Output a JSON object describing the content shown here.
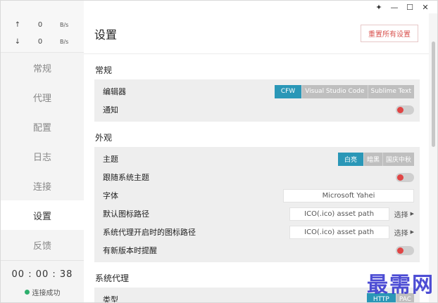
{
  "speed": {
    "up_arrow": "↑",
    "up_value": "0",
    "up_unit": "B/s",
    "down_arrow": "↓",
    "down_value": "0",
    "down_unit": "B/s"
  },
  "sidebar": {
    "items": [
      {
        "label": "常规"
      },
      {
        "label": "代理"
      },
      {
        "label": "配置"
      },
      {
        "label": "日志"
      },
      {
        "label": "连接"
      },
      {
        "label": "设置"
      },
      {
        "label": "反馈"
      }
    ],
    "active_index": 5,
    "timer": "00 : 00 : 38",
    "status": "连接成功",
    "status_color": "#2eaf6d"
  },
  "titlebar": {
    "pin": "✦",
    "minimize": "—",
    "maximize": "☐",
    "close": "✕"
  },
  "header": {
    "title": "设置",
    "reset_label": "重置所有设置"
  },
  "sections": {
    "general": {
      "title": "常规",
      "editor_label": "编辑器",
      "editor_options": [
        "CFW",
        "Visual Studio Code",
        "Sublime Text"
      ],
      "editor_selected": "CFW",
      "notify_label": "通知"
    },
    "appearance": {
      "title": "外观",
      "theme_label": "主题",
      "theme_options": [
        "白亮",
        "暗黑",
        "国庆中秋"
      ],
      "theme_selected": "白亮",
      "follow_system_label": "跟随系统主题",
      "font_label": "字体",
      "font_value": "Microsoft Yahei",
      "default_icon_label": "默认图标路径",
      "default_icon_placeholder": "ICO(.ico) asset path",
      "default_icon_choose": "选择",
      "proxy_icon_label": "系统代理开启时的图标路径",
      "proxy_icon_placeholder": "ICO(.ico) asset path",
      "proxy_icon_choose": "选择",
      "update_label": "有新版本时提醒"
    },
    "system_proxy": {
      "title": "系统代理",
      "type_label": "类型",
      "type_options": [
        "HTTP",
        "PAC"
      ]
    }
  },
  "accent_color": "#2a97b7",
  "toggle_color": "#e04545",
  "watermark": "最需网"
}
